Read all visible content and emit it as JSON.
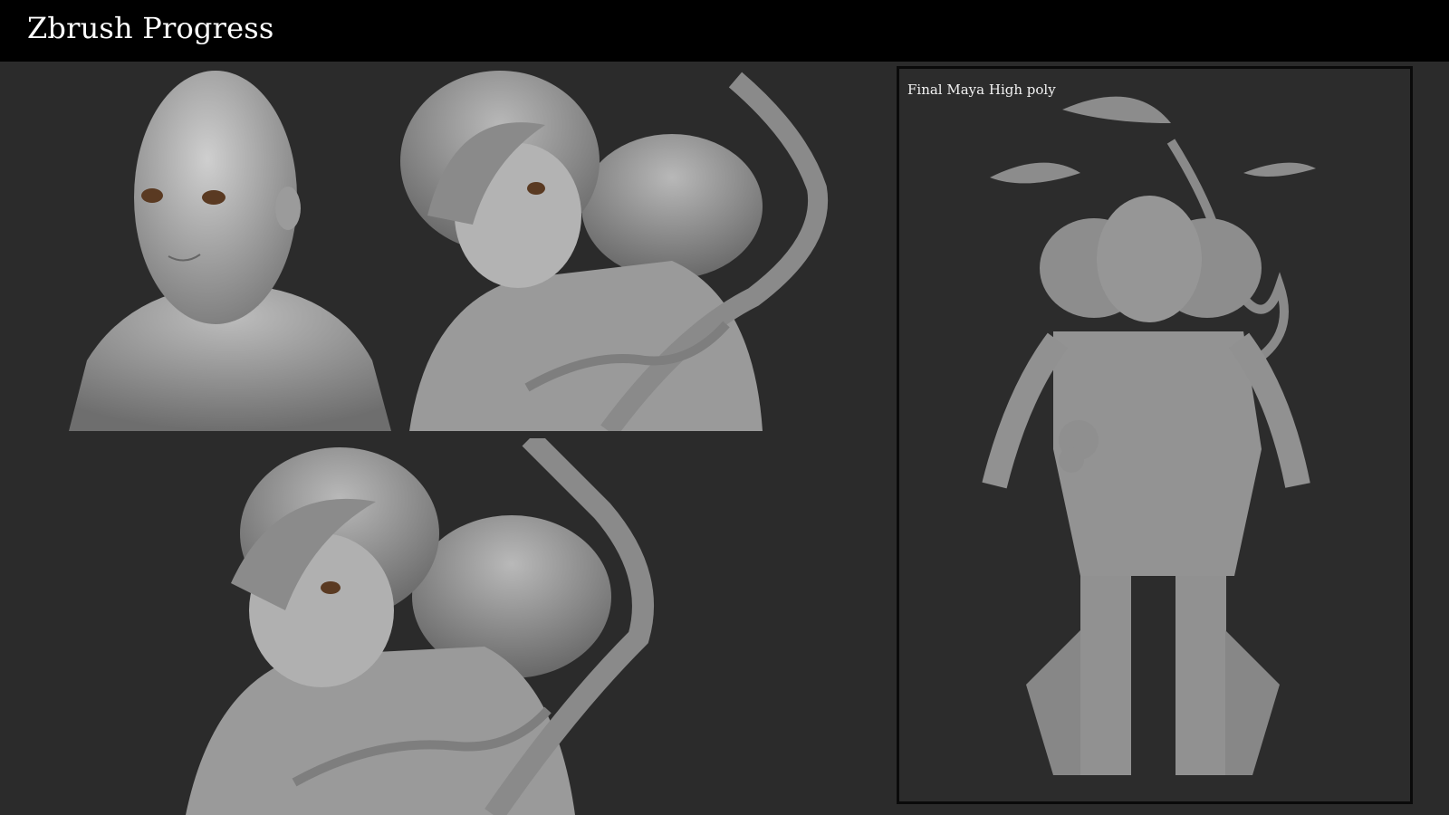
{
  "header": {
    "title": "Zbrush Progress"
  },
  "panels": [
    {
      "icon": "bust-render-icon"
    },
    {
      "icon": "character-with-vine-render-icon"
    },
    {
      "icon": "character-wip-render-icon"
    }
  ],
  "final_view": {
    "caption": "Final Maya High poly",
    "icon": "full-body-render-icon"
  },
  "colors": {
    "background": "#2b2b2b",
    "header": "#000000",
    "clay": "#9a9a9a"
  }
}
